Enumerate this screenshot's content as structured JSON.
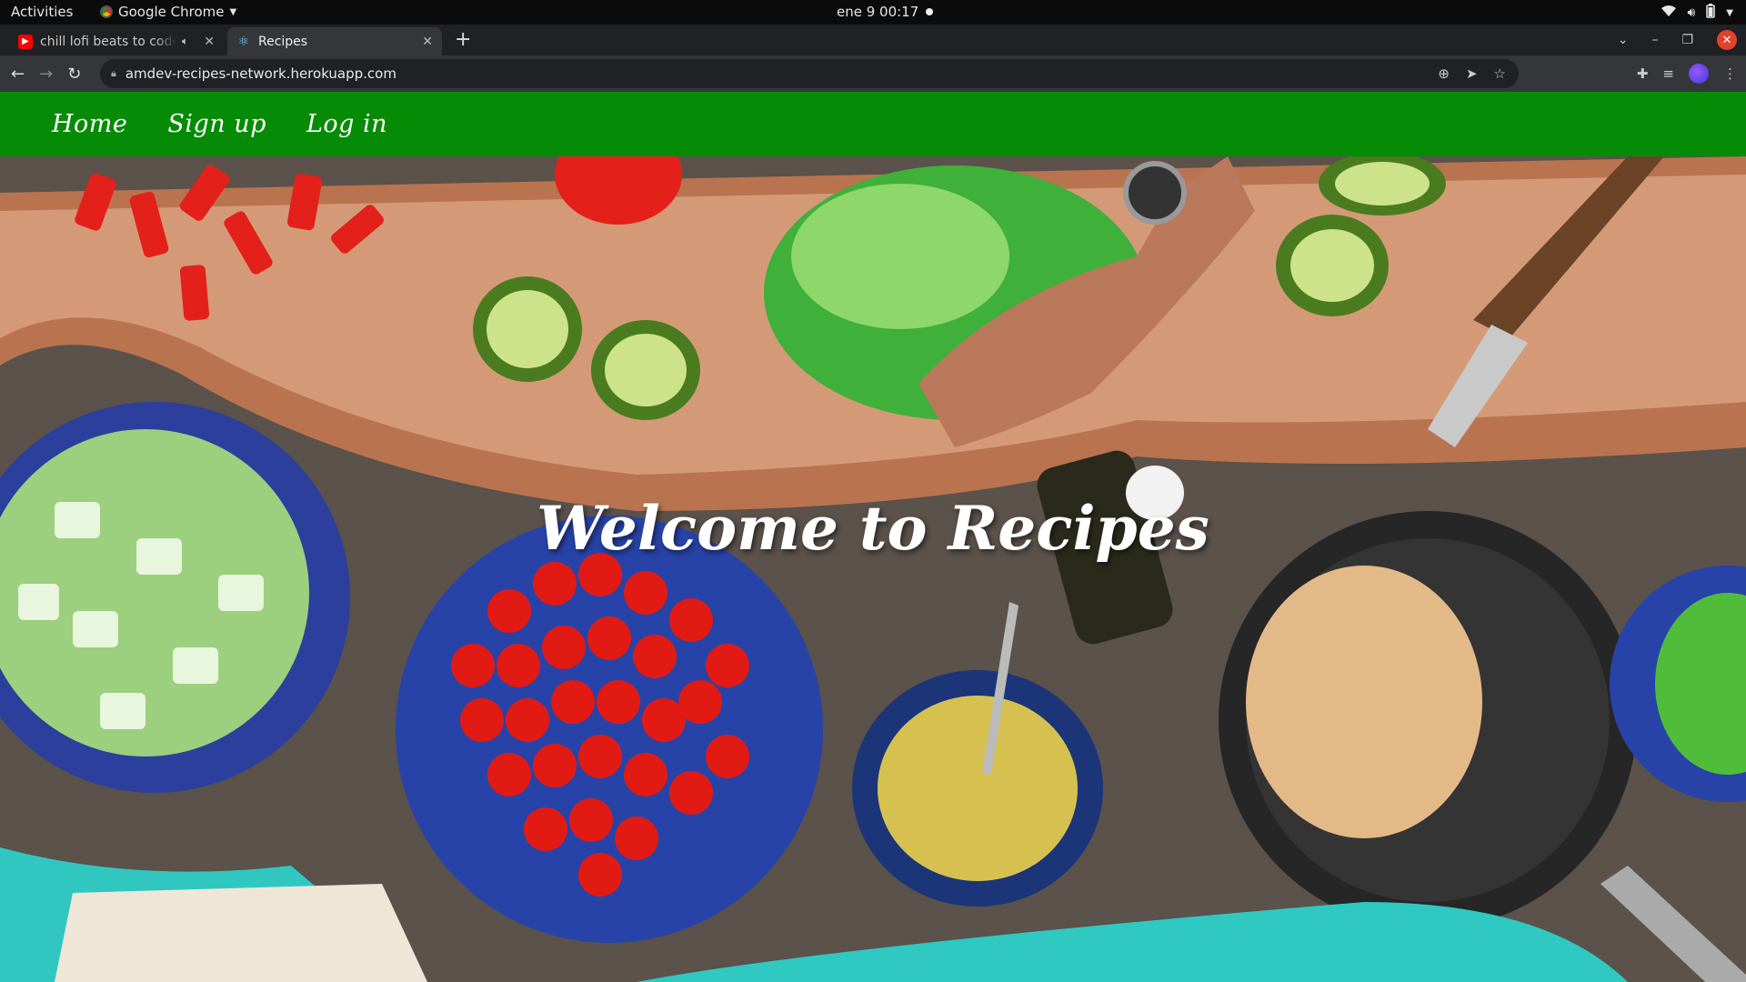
{
  "system_bar": {
    "activities": "Activities",
    "app_name": "Google Chrome",
    "clock": "ene 9  00:17"
  },
  "browser": {
    "tabs": [
      {
        "title": "chill lofi beats to code",
        "icon": "youtube-icon",
        "muted_icon": "speaker-icon"
      },
      {
        "title": "Recipes",
        "icon": "react-icon",
        "active": true
      }
    ],
    "url": "amdev-recipes-network.herokuapp.com"
  },
  "site": {
    "nav": {
      "home": "Home",
      "signup": "Sign up",
      "login": "Log in"
    },
    "hero_title": "Welcome to Recipes",
    "nav_color": "#068b06"
  }
}
